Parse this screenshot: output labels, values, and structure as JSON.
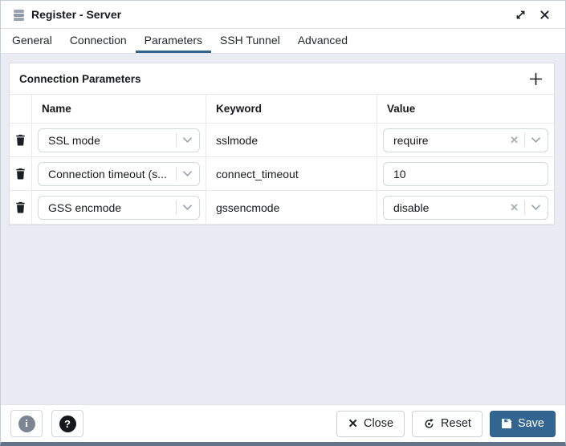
{
  "window": {
    "title": "Register - Server"
  },
  "tabs": [
    {
      "label": "General",
      "active": false
    },
    {
      "label": "Connection",
      "active": false
    },
    {
      "label": "Parameters",
      "active": true
    },
    {
      "label": "SSH Tunnel",
      "active": false
    },
    {
      "label": "Advanced",
      "active": false
    }
  ],
  "panel": {
    "title": "Connection Parameters",
    "columns": {
      "name": "Name",
      "keyword": "Keyword",
      "value": "Value"
    },
    "rows": [
      {
        "name": "SSL mode",
        "keyword": "sslmode",
        "value": "require",
        "control": "select"
      },
      {
        "name": "Connection timeout (s...",
        "keyword": "connect_timeout",
        "value": "10",
        "control": "text"
      },
      {
        "name": "GSS encmode",
        "keyword": "gssencmode",
        "value": "disable",
        "control": "select"
      }
    ]
  },
  "footer": {
    "close_label": "Close",
    "reset_label": "Reset",
    "save_label": "Save"
  },
  "colors": {
    "accent": "#326690",
    "icon_gray": "#8d99a8",
    "text": "#17191d"
  }
}
